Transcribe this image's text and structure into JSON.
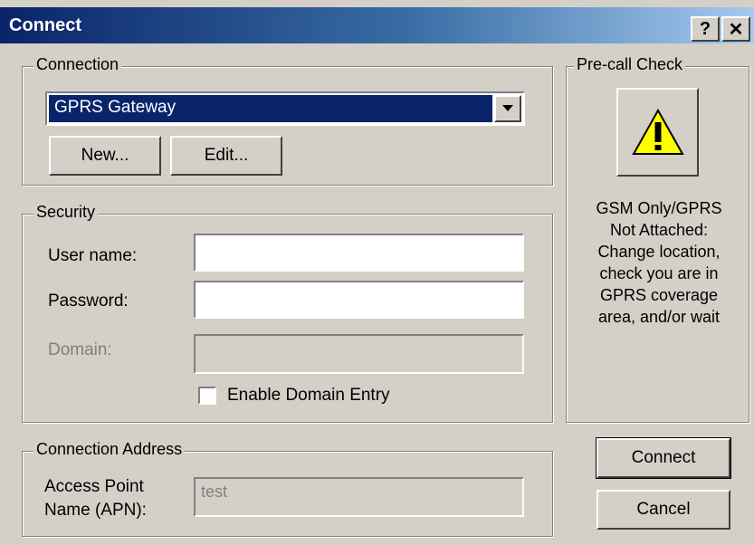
{
  "window": {
    "title": "Connect",
    "help_glyph": "?",
    "close_glyph": "✕"
  },
  "connection": {
    "legend": "Connection",
    "selected": "GPRS Gateway",
    "new_label": "New...",
    "edit_label": "Edit..."
  },
  "security": {
    "legend": "Security",
    "username_label": "User name:",
    "username_value": "",
    "password_label": "Password:",
    "password_value": "",
    "domain_label": "Domain:",
    "domain_value": "",
    "enable_domain_label": "Enable Domain Entry",
    "enable_domain_checked": false
  },
  "precall": {
    "legend": "Pre-call Check",
    "icon": "warning-icon",
    "status_lines": [
      "GSM Only/GPRS",
      "Not Attached:",
      "Change location,",
      "check you are in",
      "GPRS coverage",
      "area, and/or wait"
    ]
  },
  "address": {
    "legend": "Connection Address",
    "apn_label_line1": "Access Point",
    "apn_label_line2": "Name (APN):",
    "apn_value": "test"
  },
  "actions": {
    "connect_label": "Connect",
    "cancel_label": "Cancel"
  },
  "colors": {
    "title_start": "#0a246a",
    "title_end": "#a6caf0",
    "face": "#d4d0c8",
    "selection": "#0a246a",
    "warning": "#ffff00"
  }
}
